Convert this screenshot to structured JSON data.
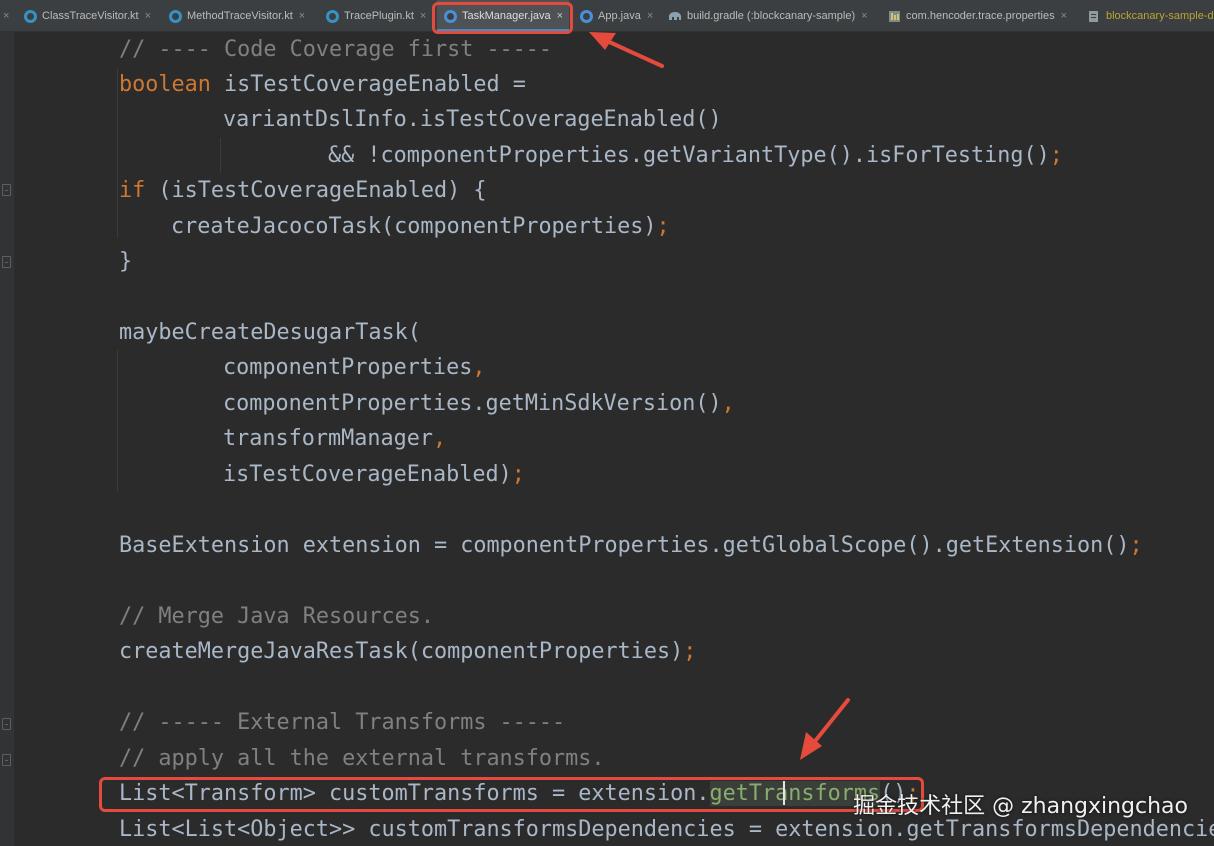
{
  "tabs": [
    {
      "label": "ClassTraceVisitor.kt",
      "icon": "kotlin-class-icon"
    },
    {
      "label": "MethodTraceVisitor.kt",
      "icon": "kotlin-class-icon"
    },
    {
      "label": "TracePlugin.kt",
      "icon": "kotlin-class-icon"
    },
    {
      "label": "TaskManager.java",
      "icon": "java-class-icon"
    },
    {
      "label": "App.java",
      "icon": "java-class-icon"
    },
    {
      "label": "build.gradle (:blockcanary-sample)",
      "icon": "gradle-elephant-icon"
    },
    {
      "label": "com.hencoder.trace.properties",
      "icon": "properties-file-icon"
    },
    {
      "label": "blockcanary-sample-d",
      "icon": "module-file-icon"
    }
  ],
  "tab_close_glyph": "×",
  "code": {
    "line1": "// ---- Code Coverage first -----",
    "line2_kw": "boolean",
    "line2_rest": " isTestCoverageEnabled =",
    "line3": "variantDslInfo.isTestCoverageEnabled()",
    "line4_main": "&& !componentProperties.getVariantType().isForTesting()",
    "line5_kw": "if",
    "line5_rest": " (isTestCoverageEnabled) {",
    "line6_main": "createJacocoTask(componentProperties)",
    "line7": "}",
    "line9": "maybeCreateDesugarTask(",
    "line10": "componentProperties",
    "line11": "componentProperties.getMinSdkVersion()",
    "line12": "transformManager",
    "line13_main": "isTestCoverageEnabled)",
    "line15_main": "BaseExtension extension = componentProperties.getGlobalScope().getExtension()",
    "line17": "// Merge Java Resources.",
    "line18_main": "createMergeJavaResTask(componentProperties)",
    "line20": "// ----- External Transforms -----",
    "line21": "// apply all the external transforms.",
    "line22_pre": "List<Transform> customTransforms = extension.",
    "line22_hl": "getTransforms",
    "line22_post": "()",
    "line23": "List<List<Object>> customTransformsDependencies = extension.getTransformsDependencie",
    "semicolon": ";",
    "comma": ","
  },
  "watermark": "掘金技术社区 @ zhangxingchao",
  "colors": {
    "background": "#2b2b2b",
    "keyword": "#cc7832",
    "comment": "#808080",
    "text": "#a9b7c6",
    "annotation": "#e44b3d",
    "active_tab_underline": "#4a88c7"
  }
}
